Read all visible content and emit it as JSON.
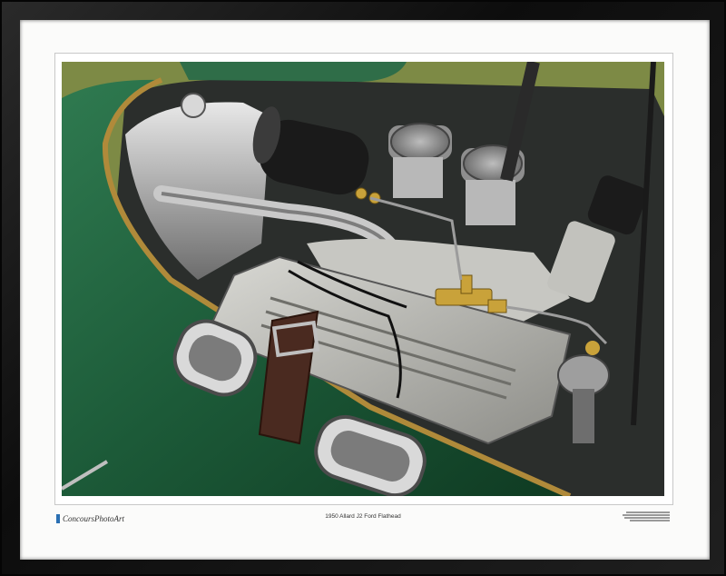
{
  "print": {
    "brand": "ConcoursPhotoArt",
    "caption": "1950 Allard J2 Ford Flathead"
  },
  "colors": {
    "frame": "#111111",
    "mat": "#fbfbfa",
    "body_green": "#1f5a3a",
    "grass": "#7d8a45",
    "brass": "#b08a3a",
    "brand_mark": "#2a6fb3"
  },
  "icons": {
    "brand_mark": "blue-square-icon"
  }
}
